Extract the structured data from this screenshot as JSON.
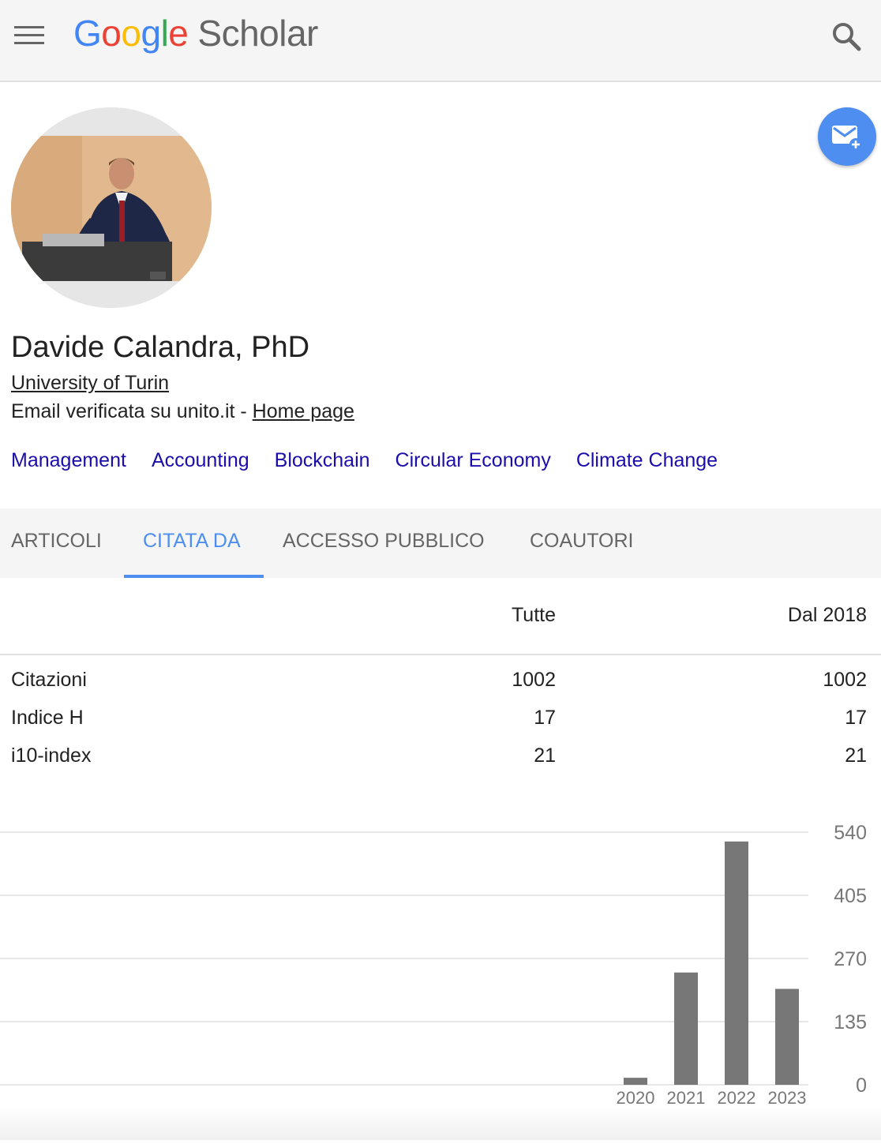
{
  "header": {
    "logo_letters": [
      "G",
      "o",
      "o",
      "g",
      "l",
      "e"
    ],
    "logo_product": "Scholar",
    "menu_icon": "hamburger-menu-icon",
    "search_icon": "search-icon",
    "background": "#f5f5f5"
  },
  "profile": {
    "name": "Davide Calandra, PhD",
    "affiliation": "University of Turin",
    "email_text": "Email verificata su unito.it - ",
    "homepage_label": "Home page",
    "photo": "profile-photo",
    "follow_icon": "email-plus-icon",
    "follow_color": "#4d8ef0",
    "interests": [
      "Management",
      "Accounting",
      "Blockchain",
      "Circular Economy",
      "Climate Change"
    ],
    "interest_color": "#1a0dab"
  },
  "tabs": [
    {
      "label": "ARTICOLI",
      "active": false
    },
    {
      "label": "CITATA DA",
      "active": true
    },
    {
      "label": "ACCESSO PUBBLICO",
      "active": false
    },
    {
      "label": "COAUTORI",
      "active": false
    }
  ],
  "stats": {
    "columns": [
      "Tutte",
      "Dal 2018"
    ],
    "rows": [
      {
        "label": "Citazioni",
        "all": "1002",
        "since": "1002"
      },
      {
        "label": "Indice H",
        "all": "17",
        "since": "17"
      },
      {
        "label": "i10-index",
        "all": "21",
        "since": "21"
      }
    ]
  },
  "chart_data": {
    "type": "bar",
    "categories": [
      "2020",
      "2021",
      "2022",
      "2023"
    ],
    "values": [
      15,
      240,
      520,
      205
    ],
    "yticks": [
      0,
      135,
      270,
      405,
      540
    ],
    "ylim": [
      0,
      540
    ],
    "grid": true,
    "y_axis_side": "right",
    "bar_color": "#777777",
    "title": "",
    "xlabel": "",
    "ylabel": ""
  }
}
